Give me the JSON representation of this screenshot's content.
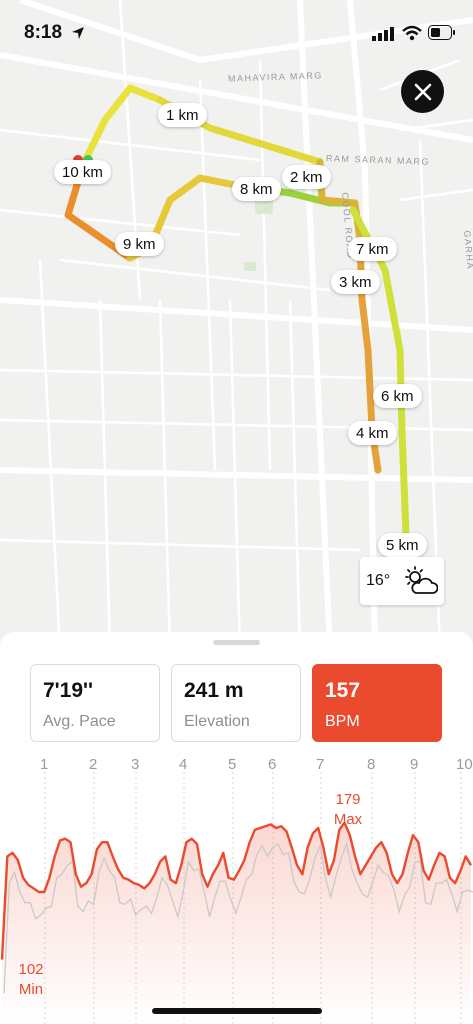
{
  "status_bar": {
    "time": "8:18"
  },
  "map": {
    "streets": [
      "MAHAVIRA MARG",
      "RAM SARAN MARG",
      "COOL ROAD",
      "GARHA"
    ],
    "km_markers": [
      "1 km",
      "2 km",
      "3 km",
      "4 km",
      "5 km",
      "6 km",
      "7 km",
      "8 km",
      "9 km",
      "10 km"
    ]
  },
  "weather": {
    "temperature": "16°",
    "icon": "partly-cloudy-icon"
  },
  "stats": [
    {
      "value": "7'19''",
      "label": "Avg. Pace"
    },
    {
      "value": "241 m",
      "label": "Elevation"
    },
    {
      "value": "157",
      "label": "BPM"
    }
  ],
  "colors": {
    "accent": "#ea4a2d",
    "route_green": "#9bd13a",
    "route_yellow": "#e8e23a",
    "route_orange": "#eb8f2c"
  },
  "chart_data": {
    "type": "line",
    "x_ticks": [
      "1",
      "2",
      "3",
      "4",
      "5",
      "6",
      "7",
      "8",
      "9",
      "10"
    ],
    "max_label": {
      "value": "179",
      "text": "Max"
    },
    "min_label": {
      "value": "102",
      "text": "Min"
    },
    "ylim": [
      95,
      185
    ],
    "series": [
      {
        "values": [
          102,
          160,
          162,
          158,
          148,
          144,
          142,
          140,
          140,
          148,
          160,
          169,
          170,
          168,
          150,
          143,
          145,
          150,
          164,
          168,
          168,
          160,
          153,
          148,
          147,
          145,
          144,
          142,
          145,
          150,
          157,
          160,
          147,
          145,
          155,
          168,
          170,
          167,
          150,
          143,
          150,
          155,
          162,
          148,
          147,
          152,
          158,
          168,
          175,
          176,
          177,
          178,
          176,
          177,
          174,
          165,
          155,
          150,
          165,
          173,
          176,
          165,
          150,
          158,
          175,
          179,
          172,
          160,
          150,
          155,
          160,
          165,
          168,
          162,
          150,
          145,
          150,
          162,
          172,
          168,
          152,
          147,
          155,
          162,
          160,
          148,
          145,
          152,
          160,
          155
        ]
      }
    ]
  }
}
